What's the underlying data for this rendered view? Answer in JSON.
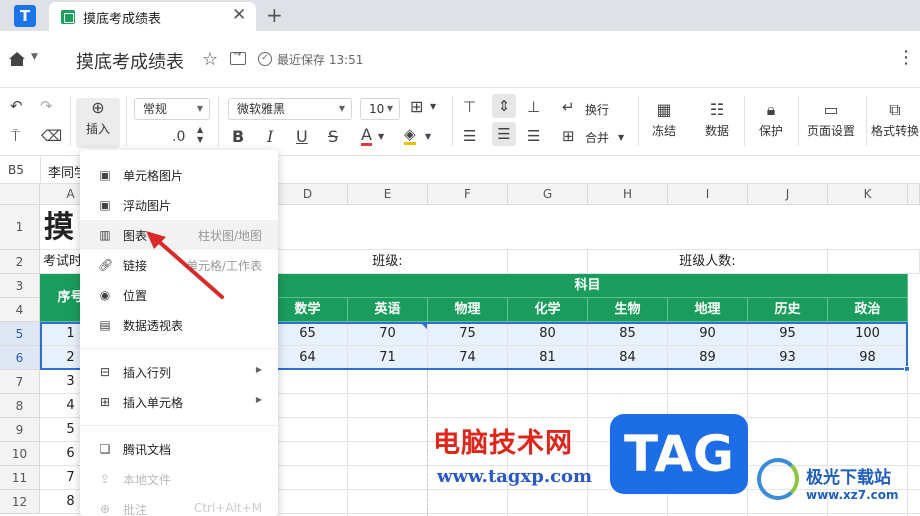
{
  "app": {
    "tab_title": "摸底考成绩表",
    "tab_close": "✕",
    "tab_add": "+"
  },
  "titlebar": {
    "doc_title": "摸底考成绩表",
    "saved_text": "最近保存 13:51"
  },
  "ribbon": {
    "insert_label": "插入",
    "number_format": "常规",
    "decimal_label": ".0",
    "font_name": "微软雅黑",
    "font_size": "10",
    "bold": "B",
    "italic": "I",
    "underline": "U",
    "strike": "S",
    "font_color": "A",
    "wrap_label": "换行",
    "merge_label": "合并",
    "freeze_label": "冻结",
    "data_label": "数据",
    "protect_label": "保护",
    "page_setup_label": "页面设置",
    "format_convert_label": "格式转换"
  },
  "formula_bar": {
    "cell_ref": "B5",
    "value": "李同学"
  },
  "columns": [
    "A",
    "D",
    "E",
    "F",
    "G",
    "H",
    "I",
    "J",
    "K"
  ],
  "rows": [
    "1",
    "2",
    "3",
    "4",
    "5",
    "6",
    "7",
    "8",
    "9",
    "10",
    "11",
    "12"
  ],
  "sheet": {
    "title_partial": "摸",
    "exam_time_partial": "考试时",
    "class_label": "班级:",
    "class_count_label": "班级人数:",
    "seq_header_partial": "序号",
    "subjects_header": "科目",
    "subjects": [
      "数学",
      "英语",
      "物理",
      "化学",
      "生物",
      "地理",
      "历史",
      "政治"
    ],
    "seq_numbers": [
      "1",
      "2",
      "3",
      "4",
      "5",
      "6",
      "7",
      "8"
    ],
    "scores": [
      [
        "65",
        "70",
        "75",
        "80",
        "85",
        "90",
        "95",
        "100"
      ],
      [
        "64",
        "71",
        "74",
        "81",
        "84",
        "89",
        "93",
        "98"
      ]
    ]
  },
  "insert_menu": {
    "items": [
      {
        "label": "单元格图片",
        "hint": ""
      },
      {
        "label": "浮动图片",
        "hint": ""
      },
      {
        "label": "图表",
        "hint": "柱状图/地图"
      },
      {
        "label": "链接",
        "hint": "单元格/工作表"
      },
      {
        "label": "位置",
        "hint": ""
      },
      {
        "label": "数据透视表",
        "hint": ""
      },
      {
        "label": "插入行列",
        "hint": ""
      },
      {
        "label": "插入单元格",
        "hint": ""
      },
      {
        "label": "腾讯文档",
        "hint": ""
      },
      {
        "label": "本地文件",
        "hint": ""
      },
      {
        "label": "批注",
        "hint": "Ctrl+Alt+M"
      }
    ]
  },
  "watermark": {
    "cn": "电脑技术网",
    "url": "www.tagxp.com",
    "tag": "TAG",
    "site_name": "极光下载站",
    "site_url": "www.xz7.com"
  },
  "colors": {
    "header_green": "#1a9c5c",
    "selection_blue": "#e8f0fb",
    "accent_blue": "#1b74e8"
  }
}
